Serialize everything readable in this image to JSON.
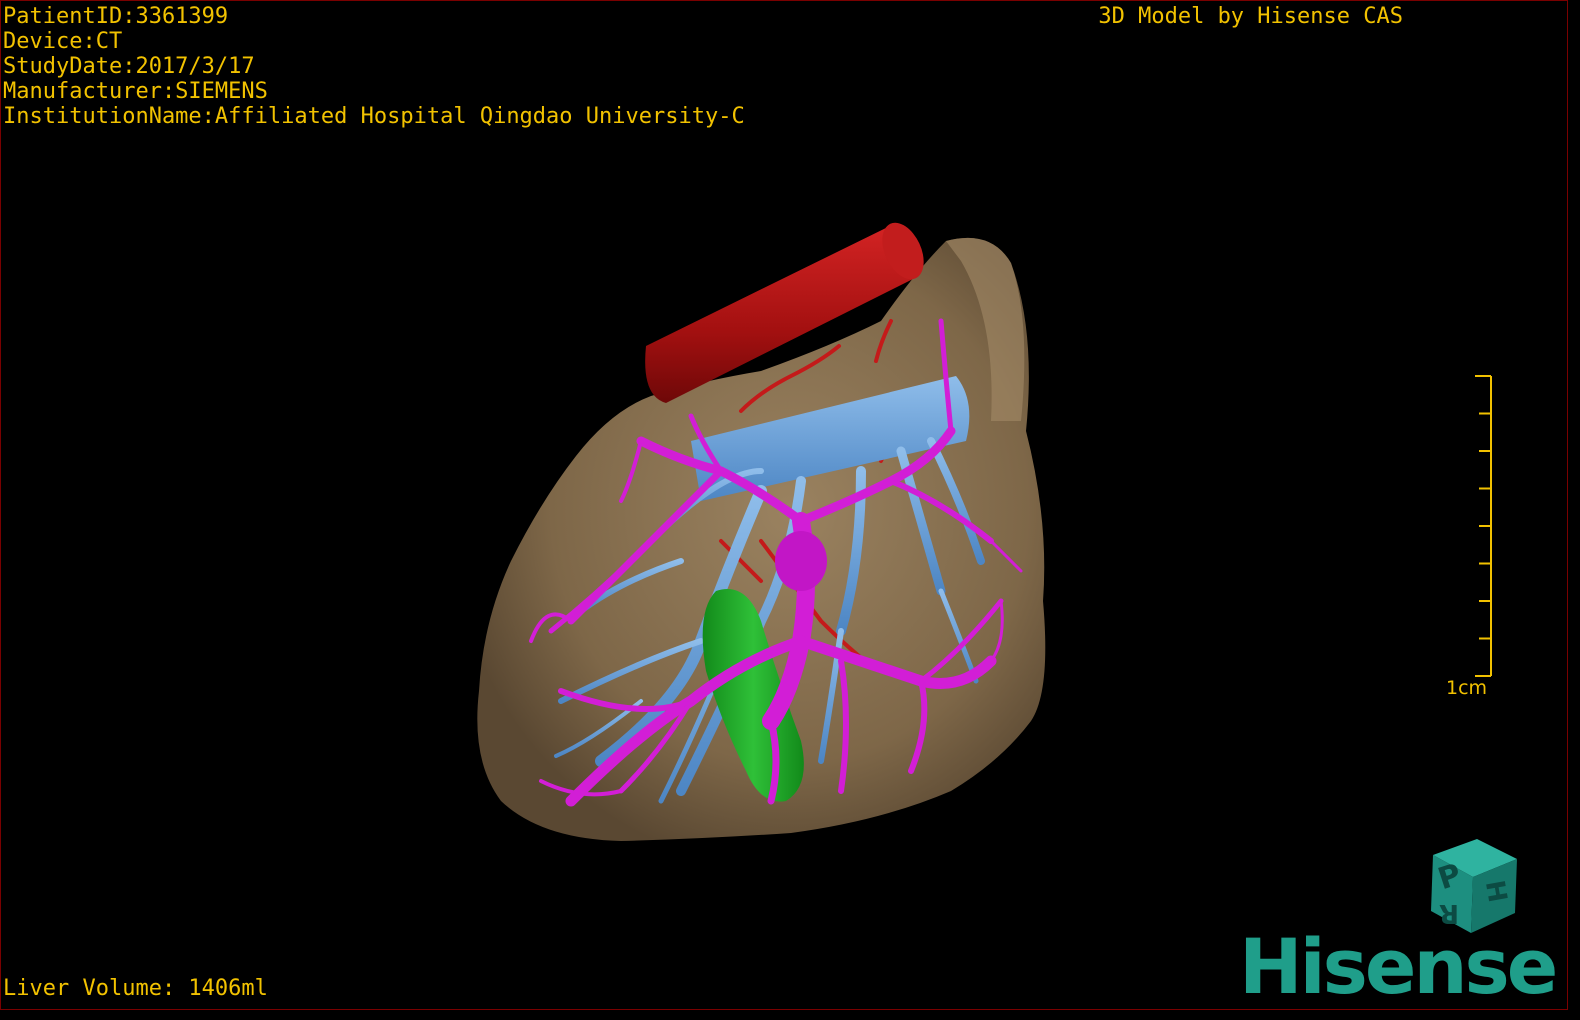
{
  "study_info": {
    "patient_id": "PatientID:3361399",
    "device": "Device:CT",
    "study_date": "StudyDate:2017/3/17",
    "manufacturer": "Manufacturer:SIEMENS",
    "institution": "InstitutionName:Affiliated Hospital Qingdao University-C"
  },
  "model_credit": "3D Model by Hisense CAS",
  "liver_volume": "Liver Volume: 1406ml",
  "scale_bar": {
    "label": "1cm",
    "ticks": 9
  },
  "orientation_cube": {
    "letters": [
      "P",
      "H",
      "R"
    ]
  },
  "brand_logo": "Hisense",
  "colors": {
    "overlay_text": "#f2c200",
    "liver": "#8a7352",
    "vena_cava": "#b01212",
    "portal_vein": "#d21ed6",
    "hepatic_vein": "#6fa6de",
    "tumor": "#22a52a",
    "artery": "#c41a1a",
    "brand": "#1f9e8a"
  }
}
